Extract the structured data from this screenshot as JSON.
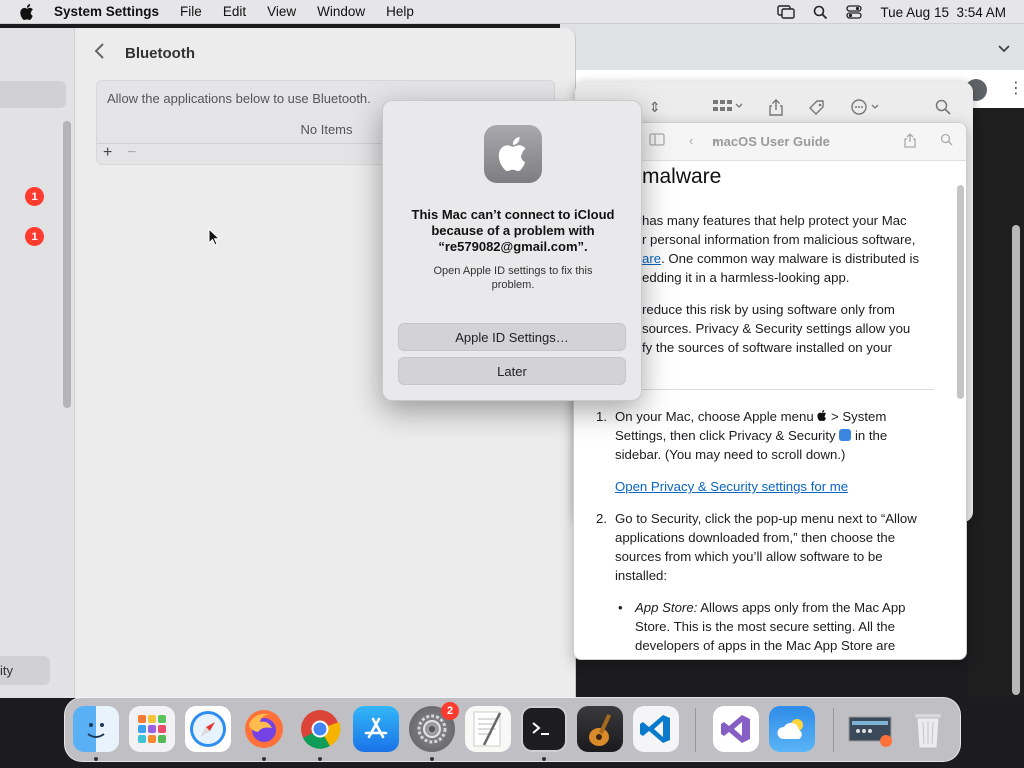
{
  "menubar": {
    "app_name": "System Settings",
    "menus": [
      "File",
      "Edit",
      "View",
      "Window",
      "Help"
    ],
    "datetime": "Tue Aug 15  3:54 AM"
  },
  "settings": {
    "title": "Bluetooth",
    "description": "Allow the applications below to use Bluetooth.",
    "empty_label": "No Items",
    "add_label": "+",
    "remove_label": "−",
    "sidebar_badges": [
      "1",
      "1"
    ],
    "sidebar_bottom_fragment": "ity"
  },
  "alert": {
    "message": "This Mac can’t connect to iCloud because of a problem with “re579082@gmail.com”.",
    "sub": "Open Apple ID settings to fix this problem.",
    "primary_button": "Apple ID Settings…",
    "secondary_button": "Later"
  },
  "guide": {
    "window_title": "macOS User Guide",
    "heading": "malware",
    "para1_a": "has many features that help protect your Mac",
    "para1_b": "r personal information from malicious software,",
    "para1_c_link": "are",
    "para1_c": ". One common way malware is distributed is",
    "para1_d": "edding it in a harmless-looking app.",
    "para2_a": "reduce this risk by using software only from",
    "para2_b": "sources. Privacy & Security settings allow you",
    "para2_c": "fy the sources of software installed on your",
    "step1_num": "1.",
    "step1_a": "On your Mac, choose Apple menu",
    "step1_b": "> System",
    "step1_c": "Settings, then click Privacy & Security",
    "step1_d": "in the",
    "step1_e": "sidebar. (You may need to scroll down.)",
    "step1_link": "Open Privacy & Security settings for me",
    "step2_num": "2.",
    "step2_a": "Go to Security, click the pop-up menu next to “Allow",
    "step2_b": "applications downloaded from,” then choose the",
    "step2_c": "sources from which you’ll allow software to be",
    "step2_d": "installed:",
    "bullet_term": "App Store:",
    "bullet_a": "Allows apps only from the Mac App",
    "bullet_b": "Store. This is the most secure setting. All the",
    "bullet_c": "developers of apps in the Mac App Store are"
  },
  "dock": {
    "apps": [
      "Finder",
      "Launchpad",
      "Safari",
      "Firefox",
      "Chrome",
      "App Store",
      "System Settings",
      "TextEdit",
      "Terminal",
      "GarageBand",
      "Visual Studio Code",
      "Visual Studio",
      "Weather",
      "Screenshot",
      "Trash"
    ],
    "system_settings_badge": "2"
  },
  "colors": {
    "accent_link": "#0a66c2",
    "badge_red": "#ff3b30"
  }
}
